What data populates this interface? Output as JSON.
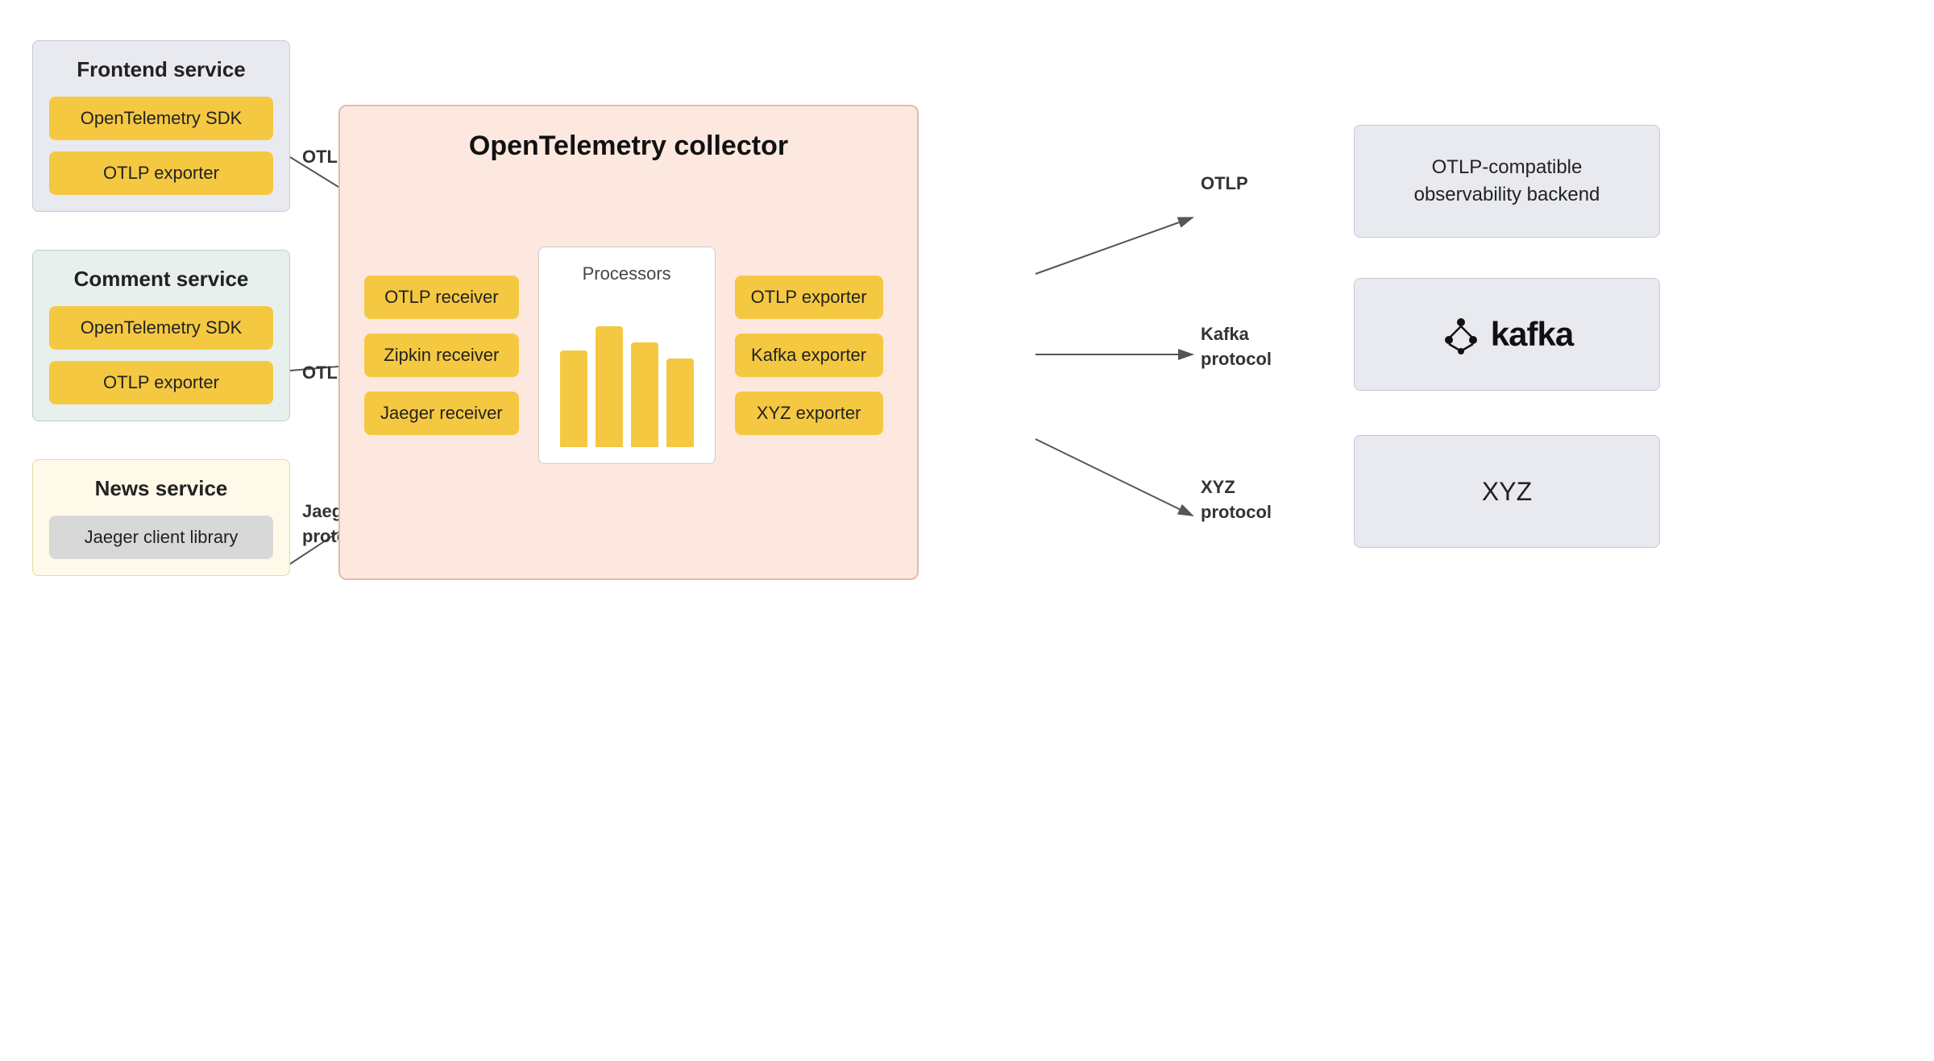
{
  "frontend_service": {
    "title": "Frontend service",
    "sdk_label": "OpenTelemetry SDK",
    "exporter_label": "OTLP exporter"
  },
  "comment_service": {
    "title": "Comment service",
    "sdk_label": "OpenTelemetry SDK",
    "exporter_label": "OTLP exporter"
  },
  "news_service": {
    "title": "News service",
    "library_label": "Jaeger client library"
  },
  "collector": {
    "title": "OpenTelemetry collector",
    "receivers": [
      "OTLP receiver",
      "Zipkin receiver",
      "Jaeger receiver"
    ],
    "processors_label": "Processors",
    "exporters": [
      "OTLP exporter",
      "Kafka exporter",
      "XYZ exporter"
    ]
  },
  "arrow_labels": {
    "otlp1": "OTLP",
    "otlp2": "OTLP",
    "jaeger_protocol": "Jaeger\nprotocol",
    "otlp_out": "OTLP",
    "kafka_protocol": "Kafka\nprotocol",
    "xyz_protocol": "XYZ\nprotocol"
  },
  "backends": {
    "otlp_backend": "OTLP-compatible\nobservability backend",
    "kafka": "kafka",
    "xyz": "XYZ"
  }
}
